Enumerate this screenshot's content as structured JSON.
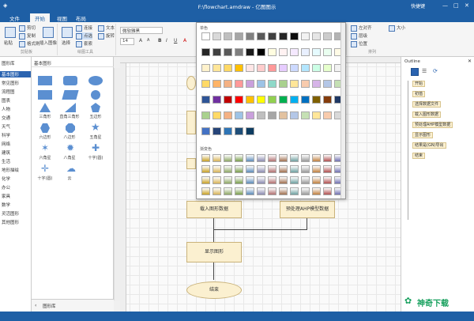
{
  "window": {
    "title": "F:\\flowchart.amdraw - 亿图图示",
    "user": "快捷键"
  },
  "menu": {
    "file": "文件",
    "start": "开始",
    "view": "视图",
    "layout": "布局"
  },
  "ribbon": {
    "paste": "粘贴",
    "cut": "剪切",
    "copy": "复制",
    "format_painter": "格式刷",
    "insert_image": "插入图像",
    "select": "选择",
    "connect": "连接",
    "text": "文本",
    "point": "点选",
    "rotate": "旋转",
    "lasso": "套索",
    "font": "微软雅黑",
    "font_size": "14",
    "group_clipboard": "剪贴板",
    "group_tools": "绘图工具",
    "group_arrange": "排列",
    "align": "左对齐",
    "layer": "层级",
    "position": "位置",
    "size": "大小"
  },
  "left_panel": {
    "header": "图形库",
    "categories": [
      "基本图形",
      "常见图形",
      "流程图",
      "图表",
      "人物",
      "交通",
      "天气",
      "科学",
      "网络",
      "建筑",
      "生活",
      "地形描绘",
      "化学",
      "办公",
      "家具",
      "数学",
      "灵活图形",
      "其他图形"
    ]
  },
  "shape_panel": {
    "header": "基本图形",
    "labels": [
      "三角形",
      "直角三角形",
      "五边形",
      "六边形",
      "八边形",
      "五角星",
      "六角星",
      "八角星",
      "十字(圆)",
      "十字(圆)",
      "云"
    ],
    "footer": "图形库"
  },
  "canvas": {
    "boxes": {
      "load": "载入图形数据",
      "preprocess": "预处理AHP模型数据",
      "show": "显示图形",
      "end": "结束"
    }
  },
  "color_popup": {
    "section1": "单色",
    "section2": "渐变色"
  },
  "outline": {
    "title": "Outline",
    "items": [
      "开始",
      "初值",
      "选择数据文件",
      "载入图形数据",
      "预处理AHP模型数据",
      "显示图形",
      "结果是(GN)导出",
      "结束"
    ]
  },
  "watermark": "神奇下载",
  "colors": {
    "accent": "#1e5fa5"
  }
}
